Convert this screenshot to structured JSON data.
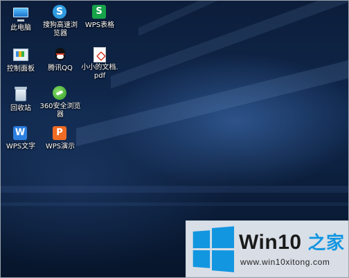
{
  "desktop": {
    "icons": [
      {
        "label": "此电脑",
        "icon": "this-pc-icon"
      },
      {
        "label": "搜狗高速浏\n览器",
        "icon": "sogou-browser-icon"
      },
      {
        "label": "WPS表格",
        "icon": "wps-spreadsheet-icon"
      },
      {
        "label": "控制面板",
        "icon": "control-panel-icon"
      },
      {
        "label": "腾讯QQ",
        "icon": "qq-icon"
      },
      {
        "label": "小小的文档.\npdf",
        "icon": "pdf-file-icon"
      },
      {
        "label": "回收站",
        "icon": "recycle-bin-icon"
      },
      {
        "label": "360安全浏览\n器",
        "icon": "360-browser-icon"
      },
      {
        "label": "WPS文字",
        "icon": "wps-writer-icon"
      },
      {
        "label": "WPS演示",
        "icon": "wps-presentation-icon"
      }
    ],
    "glyphs": {
      "sogou": "S",
      "wps_sheet": "S",
      "wps_writer": "W",
      "wps_presentation": "P"
    }
  },
  "watermark": {
    "brand": "Win10",
    "brand_suffix": "之家",
    "url": "www.win10xitong.com",
    "colors": {
      "accent": "#1296e0",
      "text": "#1a1a1a"
    }
  }
}
